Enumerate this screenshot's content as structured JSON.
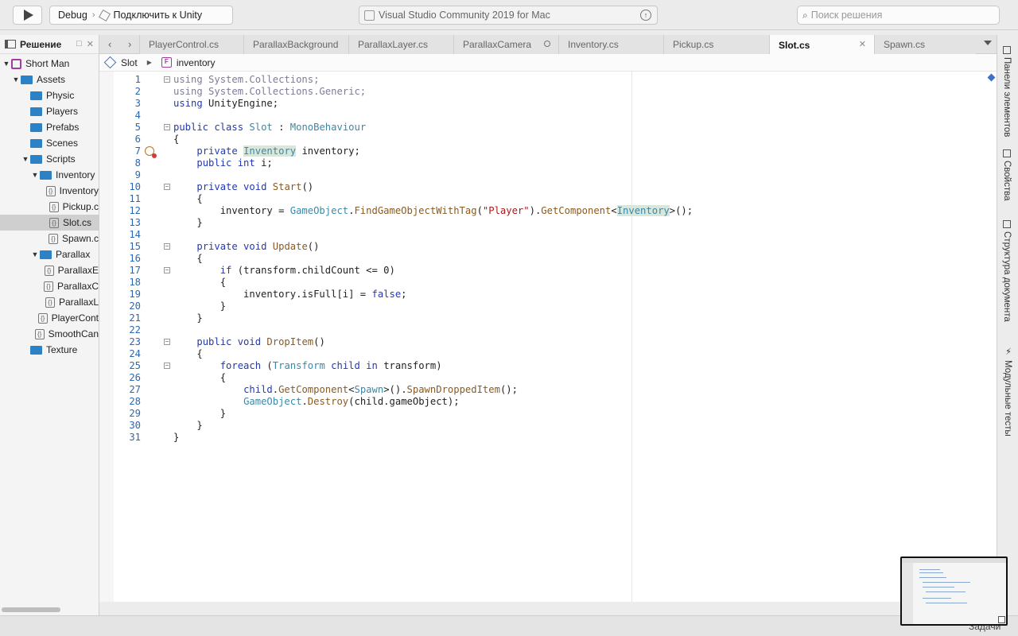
{
  "toolbar": {
    "configuration": "Debug",
    "target": "Подключить к Unity",
    "status_text": "Visual Studio Community 2019 for Mac",
    "search_placeholder": "Поиск решения"
  },
  "sidebar": {
    "title": "Решение",
    "items": [
      {
        "label": "Short Man",
        "type": "solution",
        "depth": 0,
        "expanded": true
      },
      {
        "label": "Assets",
        "type": "folder",
        "depth": 1,
        "expanded": true
      },
      {
        "label": "Physic",
        "type": "folder",
        "depth": 2
      },
      {
        "label": "Players",
        "type": "folder",
        "depth": 2
      },
      {
        "label": "Prefabs",
        "type": "folder",
        "depth": 2
      },
      {
        "label": "Scenes",
        "type": "folder",
        "depth": 2
      },
      {
        "label": "Scripts",
        "type": "folder",
        "depth": 2,
        "expanded": true
      },
      {
        "label": "Inventory",
        "type": "folder",
        "depth": 3,
        "expanded": true
      },
      {
        "label": "Inventory",
        "type": "file",
        "depth": 4
      },
      {
        "label": "Pickup.c",
        "type": "file",
        "depth": 4
      },
      {
        "label": "Slot.cs",
        "type": "file",
        "depth": 4,
        "selected": true
      },
      {
        "label": "Spawn.c",
        "type": "file",
        "depth": 4
      },
      {
        "label": "Parallax",
        "type": "folder",
        "depth": 3,
        "expanded": true
      },
      {
        "label": "ParallaxE",
        "type": "file",
        "depth": 4
      },
      {
        "label": "ParallaxC",
        "type": "file",
        "depth": 4
      },
      {
        "label": "ParallaxL",
        "type": "file",
        "depth": 4
      },
      {
        "label": "PlayerCont",
        "type": "file",
        "depth": 3
      },
      {
        "label": "SmoothCan",
        "type": "file",
        "depth": 3
      },
      {
        "label": "Texture",
        "type": "folder",
        "depth": 2
      }
    ]
  },
  "tabs": [
    {
      "label": "PlayerControl.cs"
    },
    {
      "label": "ParallaxBackground"
    },
    {
      "label": "ParallaxLayer.cs"
    },
    {
      "label": "ParallaxCamera"
    },
    {
      "label": "Inventory.cs"
    },
    {
      "label": "Pickup.cs"
    },
    {
      "label": "Slot.cs",
      "active": true
    },
    {
      "label": "Spawn.cs"
    }
  ],
  "breadcrumb": {
    "class_name": "Slot",
    "member_name": "inventory"
  },
  "code_lines": [
    "1",
    "2",
    "3",
    "4",
    "5",
    "6",
    "7",
    "8",
    "9",
    "10",
    "11",
    "12",
    "13",
    "14",
    "15",
    "16",
    "17",
    "18",
    "19",
    "20",
    "21",
    "22",
    "23",
    "24",
    "25",
    "26",
    "27",
    "28",
    "29",
    "30",
    "31"
  ],
  "right_panels": {
    "toolbox": "Панели элементов",
    "properties": "Свойства",
    "outline": "Структура документа",
    "unit_tests": "Модульные тесты"
  },
  "bottom": {
    "tasks": "Задачи"
  },
  "colors": {
    "keyword": "#2139b5",
    "type": "#3c88a8",
    "string": "#a61b1b",
    "folder": "#2d82c7"
  }
}
